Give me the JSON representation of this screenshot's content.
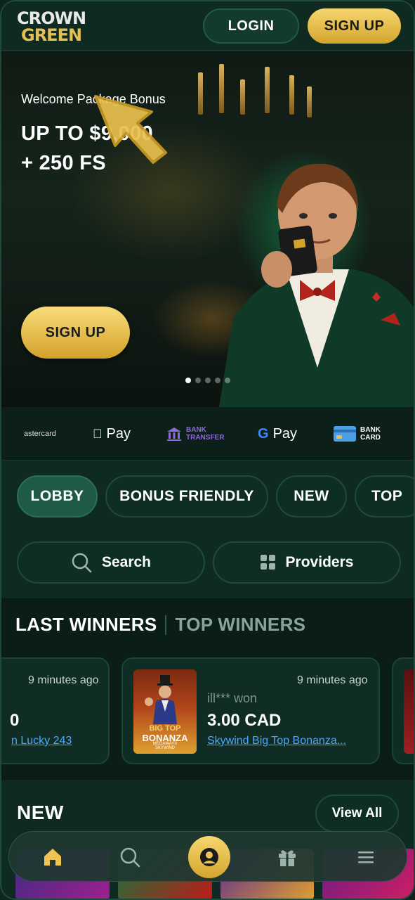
{
  "header": {
    "logo_top": "CROWN",
    "logo_bottom": "GREEN",
    "login_label": "LOGIN",
    "signup_label": "SIGN UP"
  },
  "hero": {
    "subtitle": "Welcome Package Bonus",
    "title_line1": "UP TO $9,000",
    "title_line2": "+ 250 FS",
    "signup_label": "SIGN UP",
    "carousel_dots": 5,
    "carousel_active": 1
  },
  "payments": {
    "mastercard": "astercard",
    "apple_pay": "Pay",
    "bank_transfer_1": "BANK",
    "bank_transfer_2": "TRANSFER",
    "google_pay": "Pay",
    "bank_card_1": "BANK",
    "bank_card_2": "CARD"
  },
  "tabs": [
    "LOBBY",
    "BONUS FRIENDLY",
    "NEW",
    "TOP"
  ],
  "search": {
    "label": "Search",
    "providers_label": "Providers"
  },
  "winners": {
    "tab_last": "LAST WINNERS",
    "tab_top": "TOP WINNERS",
    "cards": [
      {
        "time": "9 minutes ago",
        "amount": "0",
        "game": "n Lucky 243"
      },
      {
        "time": "9 minutes ago",
        "name": "ill*** won",
        "amount": "3.00 CAD",
        "game": "Skywind Big Top Bonanza...",
        "thumb_title1": "BIG TOP",
        "thumb_title2": "BONANZA",
        "thumb_title3": "MEGAWAYS",
        "thumb_title4": "SKYWIND"
      }
    ]
  },
  "new_section": {
    "title": "NEW",
    "view_all_label": "View All"
  },
  "colors": {
    "accent_gold": "#e6bf52",
    "bg_dark_green": "#0f2a22",
    "link_blue": "#4aa8ff"
  },
  "nav": {
    "icons": [
      "home-icon",
      "search-icon",
      "user-icon",
      "gift-icon",
      "menu-icon"
    ]
  }
}
